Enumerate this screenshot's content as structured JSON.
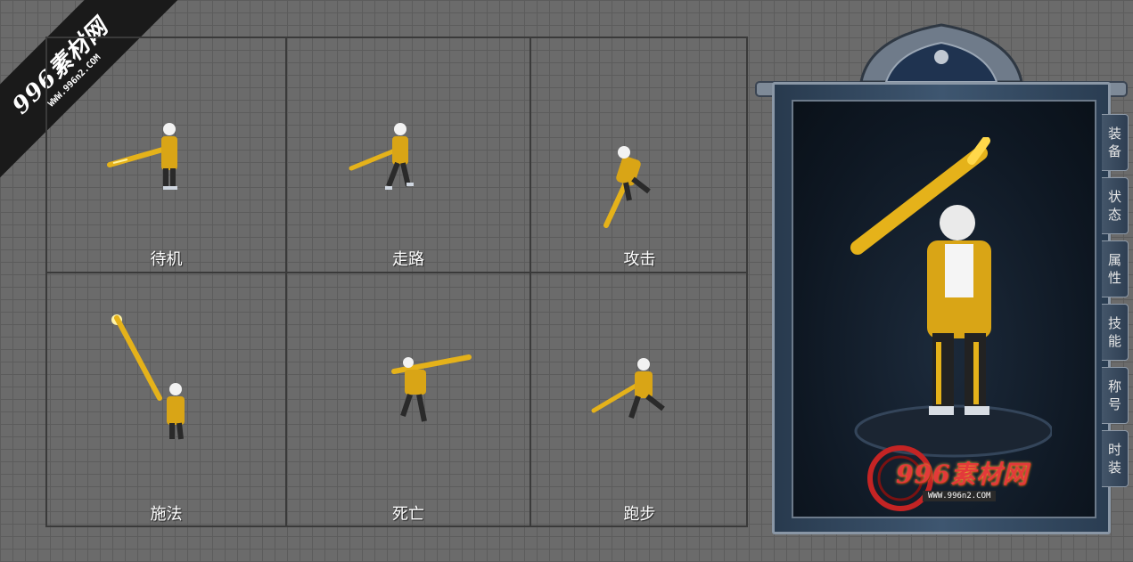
{
  "watermark": {
    "logo": "996素材网",
    "url": "WWW.996n2.COM"
  },
  "animations": [
    {
      "label": "待机"
    },
    {
      "label": "走路"
    },
    {
      "label": "攻击"
    },
    {
      "label": "施法"
    },
    {
      "label": "死亡"
    },
    {
      "label": "跑步"
    }
  ],
  "panel": {
    "tabs": [
      "装备",
      "状态",
      "属性",
      "技能",
      "称号",
      "时装"
    ]
  },
  "brand": {
    "logo": "996素材网",
    "url": "WWW.996n2.COM"
  },
  "colors": {
    "background": "#6b6b6b",
    "gold": "#e5b21a",
    "frame": "#3e5670"
  }
}
